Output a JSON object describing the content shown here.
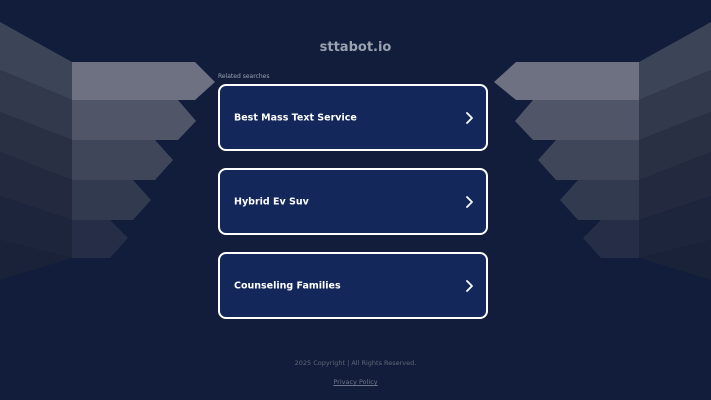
{
  "header": {
    "domain": "sttabot.io"
  },
  "related": {
    "label": "Related searches",
    "items": [
      {
        "label": "Best Mass Text Service"
      },
      {
        "label": "Hybrid Ev Suv"
      },
      {
        "label": "Counseling Families"
      }
    ]
  },
  "footer": {
    "copyright": "2025 Copyright | All Rights Reserved.",
    "privacy_label": "Privacy Policy"
  },
  "colors": {
    "background": "#111d3b",
    "card_background": "#13275a",
    "card_border": "#ffffff",
    "title_text": "#9aa1b0"
  }
}
